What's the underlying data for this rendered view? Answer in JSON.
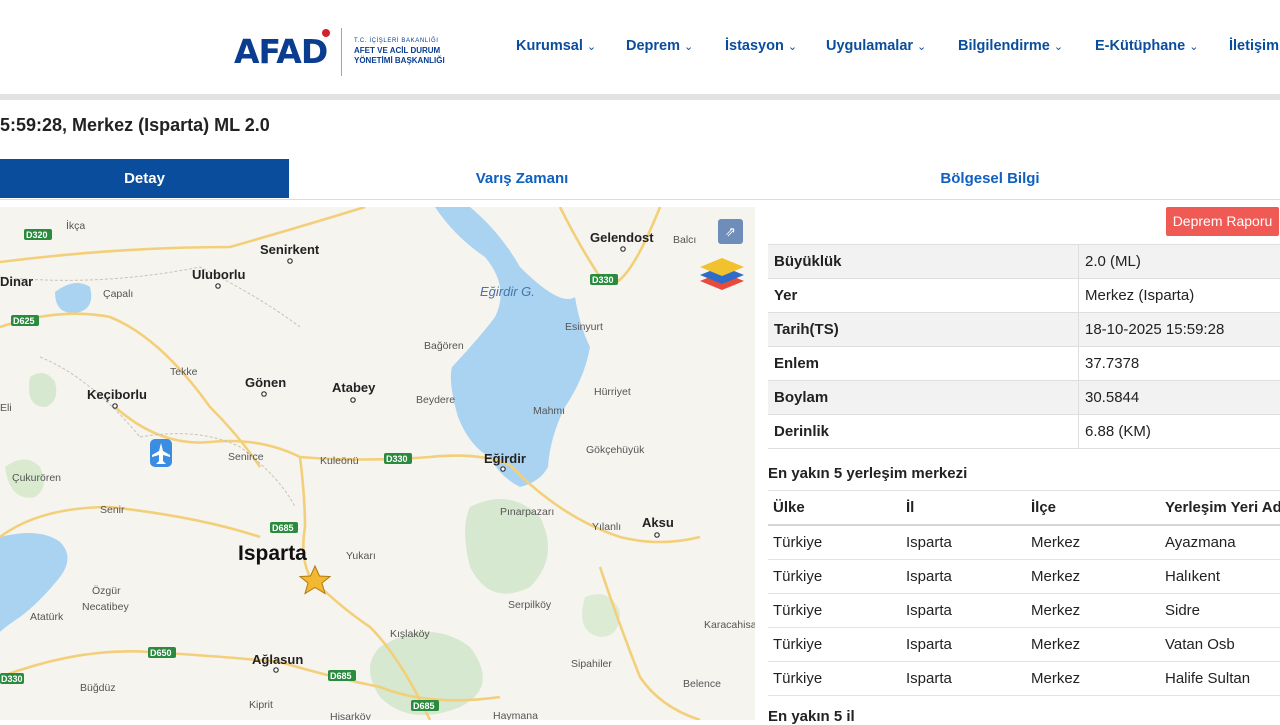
{
  "header": {
    "logo_text": "AFAD",
    "logo_line1": "T.C. İÇİŞLERİ BAKANLIĞI",
    "logo_line2": "AFET VE ACİL DURUM",
    "logo_line3": "YÖNETİMİ BAŞKANLIĞI",
    "nav": [
      "Kurumsal",
      "Deprem",
      "İstasyon",
      "Uygulamalar",
      "Bilgilendirme",
      "E-Kütüphane",
      "İletişim"
    ]
  },
  "event_title": "5:59:28, Merkez (Isparta) ML 2.0",
  "tabs": [
    "Detay",
    "Varış Zamanı",
    "Bölgesel Bilgi"
  ],
  "report_button": "Deprem Raporu",
  "details": [
    {
      "key": "Büyüklük",
      "value": "2.0 (ML)"
    },
    {
      "key": "Yer",
      "value": "Merkez (Isparta)"
    },
    {
      "key": "Tarih(TS)",
      "value": "18-10-2025 15:59:28"
    },
    {
      "key": "Enlem",
      "value": "37.7378"
    },
    {
      "key": "Boylam",
      "value": "30.5844"
    },
    {
      "key": "Derinlik",
      "value": "6.88 (KM)"
    }
  ],
  "nearest_title": "En yakın 5 yerleşim merkezi",
  "nearest_headers": [
    "Ülke",
    "İl",
    "İlçe",
    "Yerleşim Yeri Ad"
  ],
  "nearest_rows": [
    [
      "Türkiye",
      "Isparta",
      "Merkez",
      "Ayazmana"
    ],
    [
      "Türkiye",
      "Isparta",
      "Merkez",
      "Halıkent"
    ],
    [
      "Türkiye",
      "Isparta",
      "Merkez",
      "Sidre"
    ],
    [
      "Türkiye",
      "Isparta",
      "Merkez",
      "Vatan Osb"
    ],
    [
      "Türkiye",
      "Isparta",
      "Merkez",
      "Halife Sultan"
    ]
  ],
  "nearest_il_title": "En yakın 5 il",
  "map": {
    "lake_label": "Eğirdir G.",
    "city_label": "Isparta",
    "towns_bold": [
      "Senirkent",
      "Uluborlu",
      "Gelendost",
      "Dinar",
      "Keçiborlu",
      "Gönen",
      "Atabey",
      "Eğirdir",
      "Aksu",
      "Ağlasun"
    ],
    "places": [
      "Balcı",
      "Çapalı",
      "İkça",
      "Tekke",
      "Bağören",
      "Esinyurt",
      "Beydere",
      "Hürriyet",
      "Mahmı",
      "Gökçehüyük",
      "Senirce",
      "Kuleönü",
      "Çukurören",
      "Senir",
      "Pınarpazarı",
      "Yılanlı",
      "Yukarı",
      "Özgür",
      "Necatibey",
      "Atatürk",
      "Serpilköy",
      "Kışlaköy",
      "Karacahisar",
      "Sipahiler",
      "Büğdüz",
      "Belence",
      "Kiprit",
      "Hisarköy",
      "Haymana",
      "Eli"
    ],
    "roads": [
      "D320",
      "D625",
      "D330",
      "D330",
      "D685",
      "D650",
      "D685",
      "D685",
      "D330"
    ]
  }
}
